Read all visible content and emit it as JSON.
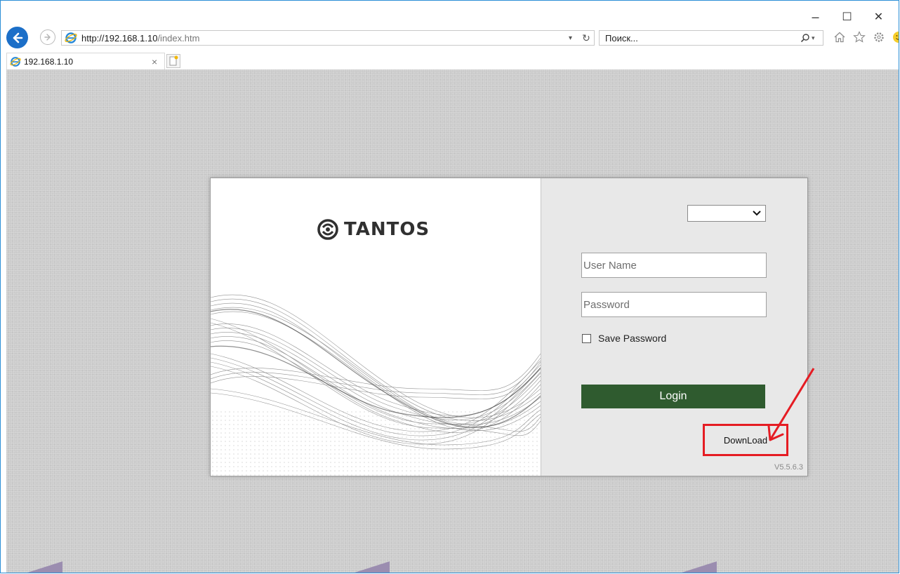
{
  "browser": {
    "address_host": "http://192.168.1.10",
    "address_path": "/index.htm",
    "search_placeholder": "Поиск...",
    "tab_title": "192.168.1.10",
    "window_controls": {
      "minimize": "–",
      "maximize": "☐",
      "close": "✕"
    }
  },
  "login": {
    "brand": "TANTOS",
    "language_selected": "",
    "username_placeholder": "User Name",
    "password_placeholder": "Password",
    "save_password_label": "Save Password",
    "save_password_checked": false,
    "login_button": "Login",
    "download_link": "DownLoad",
    "version": "V5.5.6.3"
  },
  "icons": {
    "back": "back-arrow-icon",
    "forward": "forward-arrow-icon",
    "page": "internet-explorer-icon",
    "refresh": "refresh-icon",
    "search": "search-icon",
    "home": "home-icon",
    "favorites": "star-icon",
    "settings": "gear-icon",
    "feedback": "smiley-icon"
  },
  "colors": {
    "login_button": "#2f5b2f",
    "highlight": "#e51c23",
    "back_button": "#1c6fc8"
  }
}
